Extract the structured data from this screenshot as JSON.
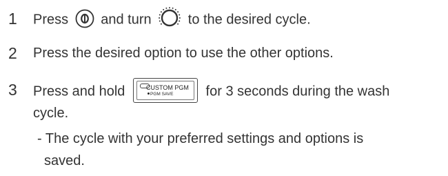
{
  "steps": [
    {
      "number": "1",
      "text_before": "Press",
      "power_icon": "power-button-icon",
      "text_middle": "and turn",
      "dial_icon": "cycle-dial-icon",
      "text_after": "to the desired cycle."
    },
    {
      "number": "2",
      "text": "Press the desired option to use the other options."
    },
    {
      "number": "3",
      "text_before": "Press and hold",
      "button": {
        "label": "CUSTOM PGM",
        "sublabel": "PGM SAVE"
      },
      "text_after": "for 3 seconds during the wash",
      "text_line2": "cycle."
    }
  ],
  "note": {
    "line1": "- The cycle with your preferred settings and options is",
    "line2": "saved."
  }
}
